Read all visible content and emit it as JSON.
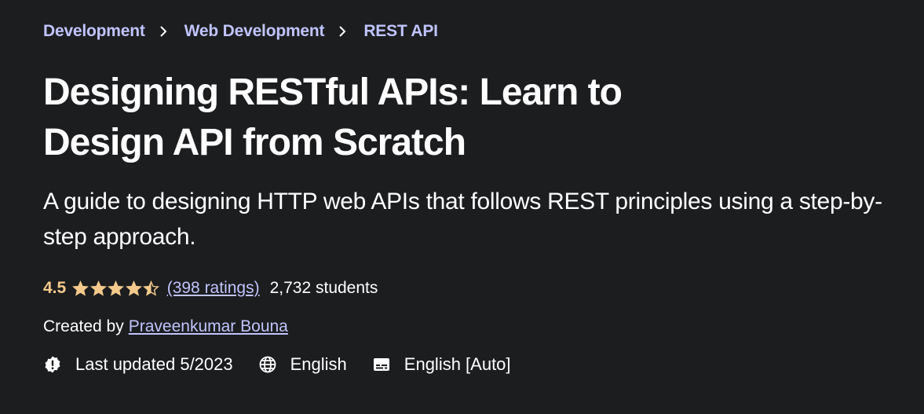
{
  "breadcrumb": [
    {
      "label": "Development"
    },
    {
      "label": "Web Development"
    },
    {
      "label": "REST API"
    }
  ],
  "course": {
    "title": "Designing RESTful APIs: Learn to Design API from Scratch",
    "subtitle": "A guide to designing HTTP web APIs that follows REST principles using a step-by-step approach."
  },
  "rating": {
    "value": "4.5",
    "stars_filled": 4.5,
    "stars_total": 5,
    "ratings_text": "(398 ratings)",
    "students_text": "2,732 students"
  },
  "creator": {
    "label": "Created by",
    "name": "Praveenkumar Bouna"
  },
  "meta": {
    "last_updated": "Last updated 5/2023",
    "language": "English",
    "captions": "English [Auto]"
  },
  "colors": {
    "background": "#1c1d1f",
    "link": "#c0c4fc",
    "rating": "#f3ca8c",
    "text": "#ffffff"
  }
}
